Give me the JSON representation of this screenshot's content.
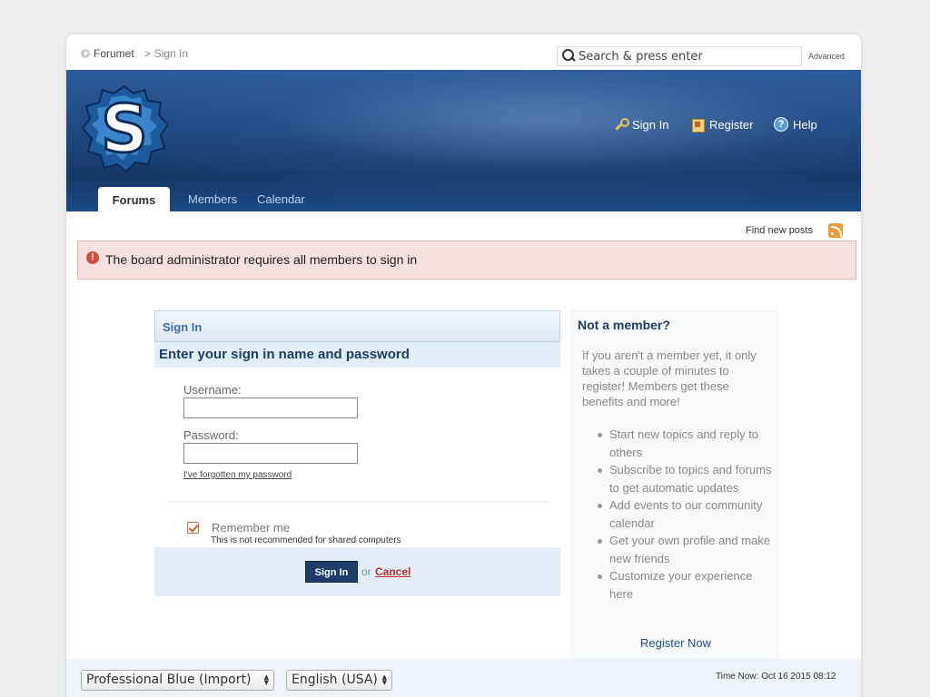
{
  "breadcrumb": {
    "home": "Forumet",
    "separator": ">",
    "current": "Sign In"
  },
  "search": {
    "placeholder": "Search & press enter",
    "advanced": "Advanced"
  },
  "header": {
    "links": [
      {
        "label": "Sign In",
        "icon": "key-icon"
      },
      {
        "label": "Register",
        "icon": "register-icon"
      },
      {
        "label": "Help",
        "icon": "help-icon"
      }
    ],
    "tabs": [
      {
        "label": "Forums",
        "active": true
      },
      {
        "label": "Members",
        "active": false
      },
      {
        "label": "Calendar",
        "active": false
      }
    ]
  },
  "find_new_posts": "Find new posts",
  "alert": {
    "text": "The board administrator requires all members to sign in",
    "icon_glyph": "!"
  },
  "signin": {
    "title": "Sign In",
    "subtitle": "Enter your sign in name and password",
    "username_label": "Username:",
    "username_value": "",
    "password_label": "Password:",
    "password_value": "",
    "forgot": "I've forgotten my password",
    "remember_label": "Remember me",
    "remember_checked": true,
    "remember_note": "This is not recommended for shared computers",
    "submit": "Sign In",
    "or": "or",
    "cancel": "Cancel"
  },
  "member_box": {
    "title": "Not a member?",
    "intro": "If you aren't a member yet, it only takes a couple of minutes to register! Members get these benefits and more!",
    "benefits": [
      "Start new topics and reply to others",
      "Subscribe to topics and forums to get automatic updates",
      "Add events to our community calendar",
      "Get your own profile and make new friends",
      "Customize your experience here"
    ],
    "cta": "Register Now"
  },
  "footer": {
    "skin": "Professional Blue (Import)",
    "language": "English (USA)",
    "time": "Time Now: Oct 16 2015 08:12"
  },
  "colors": {
    "banner": "#1e477f",
    "alert_bg": "#f6e0e0",
    "accent": "#1c3d6a",
    "cancel": "#c0312b"
  }
}
